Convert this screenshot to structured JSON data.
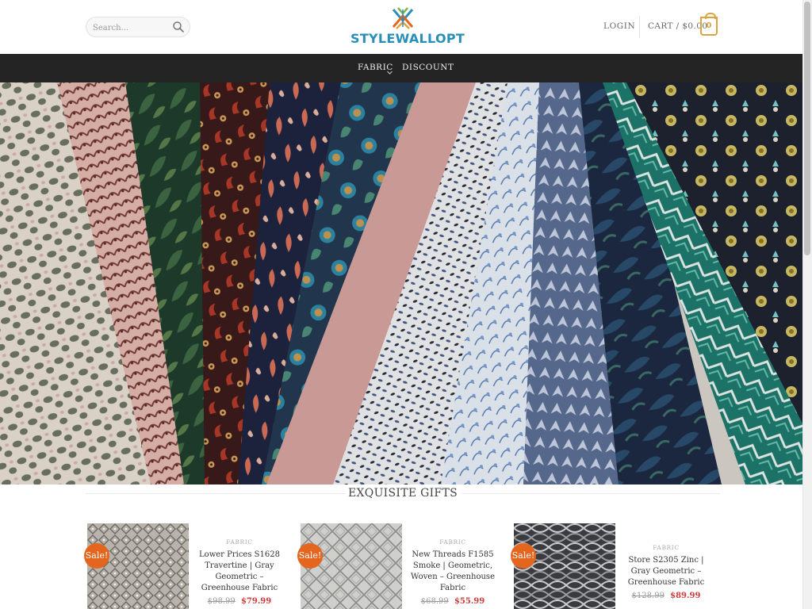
{
  "header": {
    "search_placeholder": "Search...",
    "logo_text": "STYLEWALLOPT",
    "login_label": "LOGIN",
    "cart_label": "CART / $0.00",
    "cart_count": "0"
  },
  "nav": {
    "items": [
      {
        "label": "FABRIC",
        "has_dropdown": true
      },
      {
        "label": "DISCOUNT",
        "has_dropdown": false
      }
    ]
  },
  "hero": {
    "image": "fabric-swatches-fan"
  },
  "section": {
    "title": "EXQUISITE GIFTS"
  },
  "products": [
    {
      "badge": "Sale!",
      "category": "FABRIC",
      "title": "Lower Prices S1628 Travertine | Gray Geometric – Greenhouse Fabric",
      "old_price": "$98.99",
      "new_price": "$79.99"
    },
    {
      "badge": "Sale!",
      "category": "FABRIC",
      "title": "New Threads F1585 Smoke | Geometric, Woven – Greenhouse Fabric",
      "old_price": "$68.99",
      "new_price": "$55.99"
    },
    {
      "badge": "Sale!",
      "category": "FABRIC",
      "title": "Store S2305 Zinc | Gray Geometric – Greenhouse Fabric",
      "old_price": "$128.99",
      "new_price": "$89.99"
    }
  ],
  "colors": {
    "nav_bg": "#242424",
    "logo_blue": "#2a8fb8",
    "cart_gold": "#d9a441",
    "sale_orange": "#e4661e",
    "price_red": "#d13a3a"
  }
}
